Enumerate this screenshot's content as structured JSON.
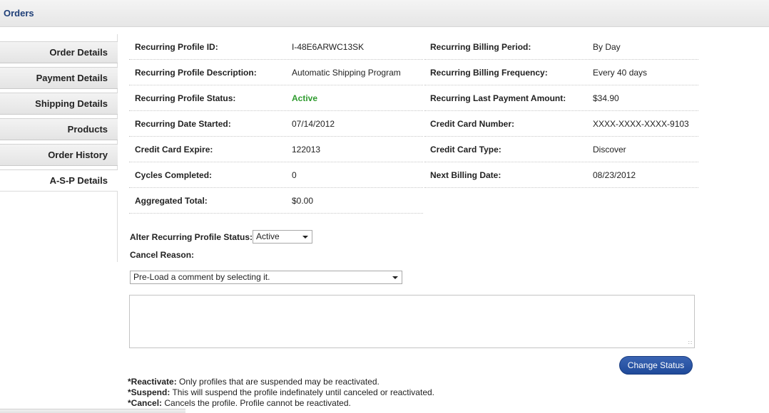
{
  "header": {
    "title": "Orders"
  },
  "sidebar": {
    "items": [
      {
        "label": "Order Details"
      },
      {
        "label": "Payment Details"
      },
      {
        "label": "Shipping Details"
      },
      {
        "label": "Products"
      },
      {
        "label": "Order History"
      },
      {
        "label": "A-S-P Details"
      }
    ],
    "active": "A-S-P Details"
  },
  "details": {
    "left": [
      {
        "label": "Recurring Profile ID:",
        "value": "I-48E6ARWC13SK"
      },
      {
        "label": "Recurring Profile Description:",
        "value": "Automatic Shipping Program"
      },
      {
        "label": "Recurring Profile Status:",
        "value": "Active"
      },
      {
        "label": "Recurring Date Started:",
        "value": "07/14/2012"
      },
      {
        "label": "Credit Card Expire:",
        "value": "122013"
      },
      {
        "label": "Cycles Completed:",
        "value": "0"
      },
      {
        "label": "Aggregated Total:",
        "value": "$0.00"
      }
    ],
    "right": [
      {
        "label": "Recurring Billing Period:",
        "value": "By Day"
      },
      {
        "label": "Recurring Billing Frequency:",
        "value": "Every 40 days"
      },
      {
        "label": "Recurring Last Payment Amount:",
        "value": "$34.90"
      },
      {
        "label": "Credit Card Number:",
        "value": "XXXX-XXXX-XXXX-9103"
      },
      {
        "label": "Credit Card Type:",
        "value": "Discover"
      },
      {
        "label": "Next Billing Date:",
        "value": "08/23/2012"
      }
    ]
  },
  "status_color": "#2e9b2e",
  "form": {
    "alter_label": "Alter Recurring Profile Status:",
    "alter_selected": "Active",
    "cancel_label": "Cancel Reason:",
    "comment_selected": "Pre-Load a comment by selecting it.",
    "submit_label": "Change Status"
  },
  "notes": [
    {
      "term": "*Reactivate:",
      "text": " Only profiles that are suspended may be reactivated."
    },
    {
      "term": "*Suspend:",
      "text": " This will suspend the profile indefinately until canceled or reactivated."
    },
    {
      "term": "*Cancel:",
      "text": " Cancels the profile. Profile cannot be reactivated."
    }
  ],
  "button_color": "#2a55a6"
}
